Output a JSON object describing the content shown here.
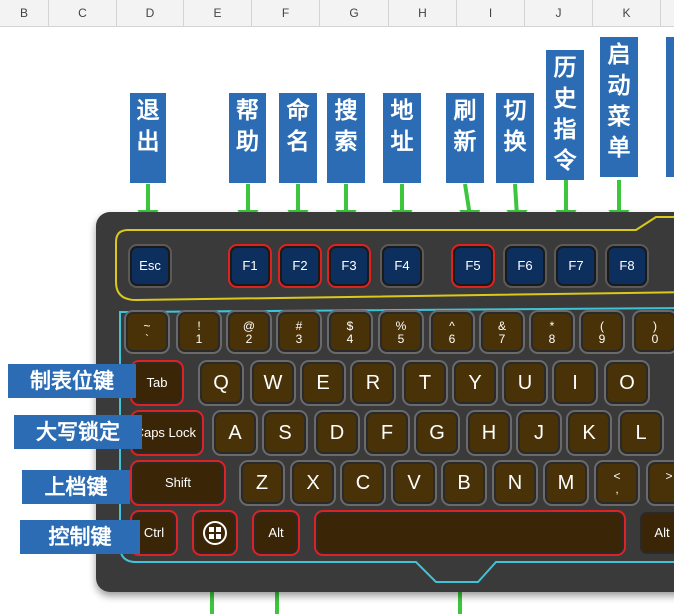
{
  "sheet": {
    "columns": [
      "B",
      "C",
      "D",
      "E",
      "F",
      "G",
      "H",
      "I",
      "J",
      "K",
      ""
    ]
  },
  "top_labels": [
    "退出",
    "帮助",
    "命名",
    "搜索",
    "地址",
    "刷新",
    "切换",
    "历史指令",
    "启动菜单"
  ],
  "side_labels": [
    "制表位键",
    "大写锁定",
    "上档键",
    "控制键"
  ],
  "keys": {
    "esc": "Esc",
    "f1": "F1",
    "f2": "F2",
    "f3": "F3",
    "f4": "F4",
    "f5": "F5",
    "f6": "F6",
    "f7": "F7",
    "f8": "F8",
    "num_top": [
      "~",
      "!",
      "@",
      "#",
      "$",
      "%",
      "^",
      "&",
      "*",
      "(",
      ")"
    ],
    "num_bottom": [
      "`",
      "1",
      "2",
      "3",
      "4",
      "5",
      "6",
      "7",
      "8",
      "9",
      "0"
    ],
    "row_q": [
      "Q",
      "W",
      "E",
      "R",
      "T",
      "Y",
      "U",
      "I",
      "O"
    ],
    "row_a": [
      "A",
      "S",
      "D",
      "F",
      "G",
      "H",
      "J",
      "K",
      "L"
    ],
    "row_z": [
      "Z",
      "X",
      "C",
      "V",
      "B",
      "N",
      "M",
      "<",
      ">"
    ],
    "row_z_sub": [
      "",
      ",",
      ""
    ],
    "tab": "Tab",
    "caps": "Caps Lock",
    "shift": "Shift",
    "ctrl": "Ctrl",
    "alt_left": "Alt",
    "alt_right": "Alt"
  },
  "colors": {
    "label_bg": "#2b6cb5",
    "arrow": "#3cc63c",
    "outline_yellow": "#d9c91a",
    "outline_cyan": "#3fc3d6",
    "highlight_red": "#d22222"
  }
}
